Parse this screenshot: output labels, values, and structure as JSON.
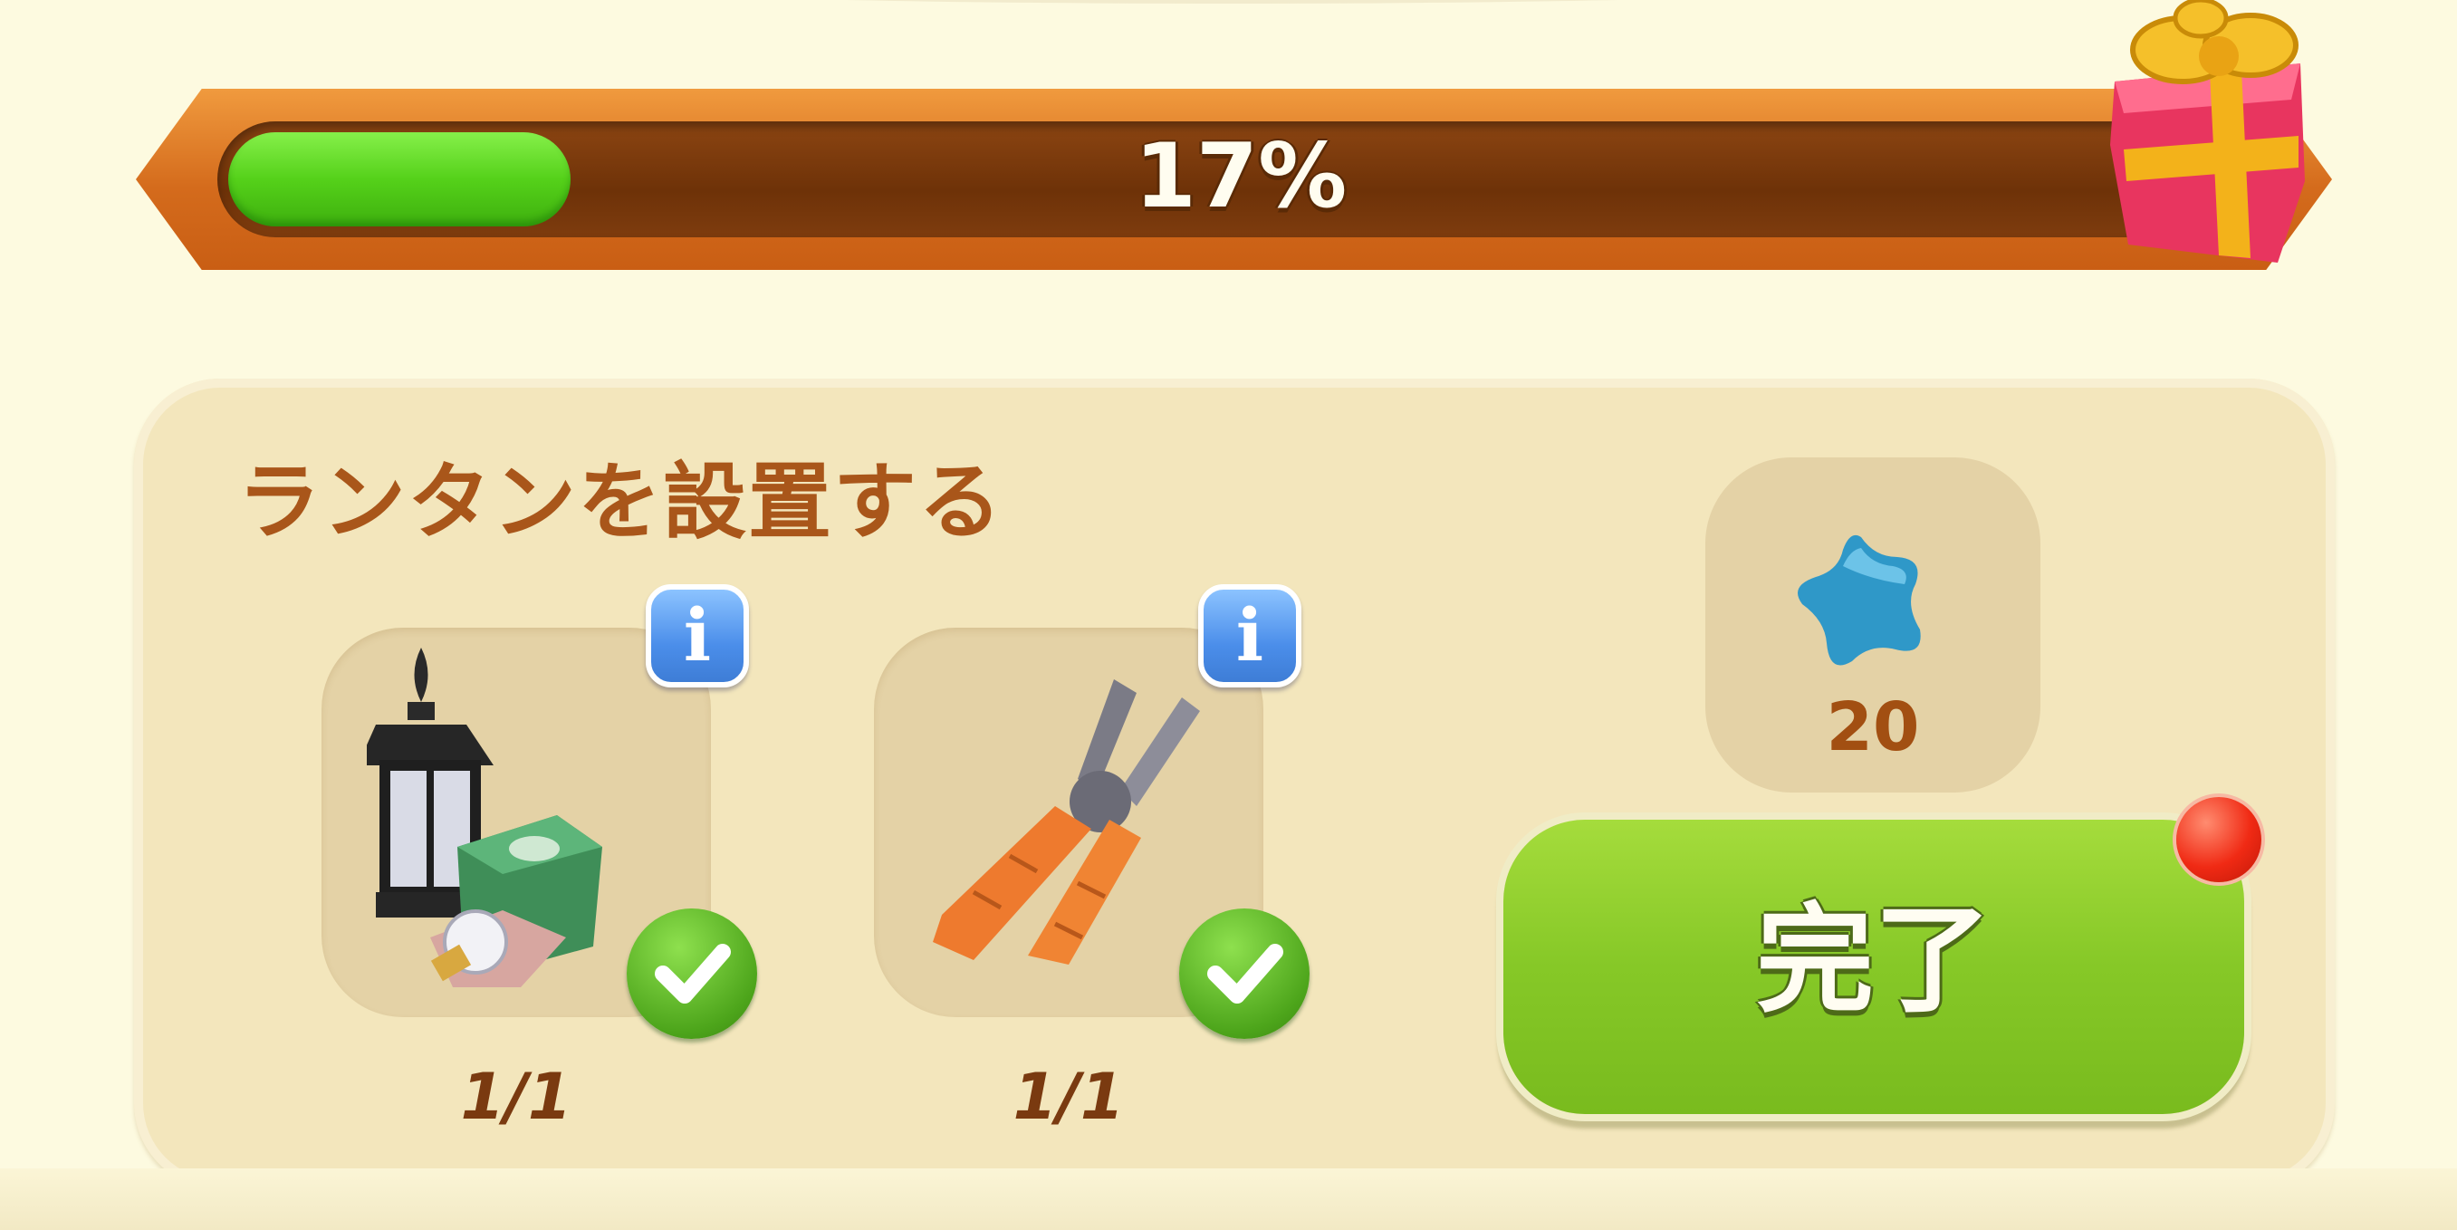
{
  "progress": {
    "percent": 17,
    "label": "17%",
    "reward_icon": "gift-box-icon"
  },
  "quest": {
    "title": "ランタンを設置する",
    "items": [
      {
        "icon": "lantern-and-bulb-icon",
        "count": "1/1",
        "completed": true
      },
      {
        "icon": "pliers-icon",
        "count": "1/1",
        "completed": true
      }
    ],
    "reward": {
      "icon": "blue-star-icon",
      "amount": "20"
    },
    "complete_button": {
      "label": "完了",
      "has_notification": true
    }
  },
  "colors": {
    "background": "#fdfae0",
    "bar_frame": "#d46b1c",
    "bar_fill": "#55d11a",
    "title_text": "#a9561a",
    "button_green": "#86c827",
    "info_blue": "#4b8eea",
    "notification_red": "#f02a14"
  }
}
